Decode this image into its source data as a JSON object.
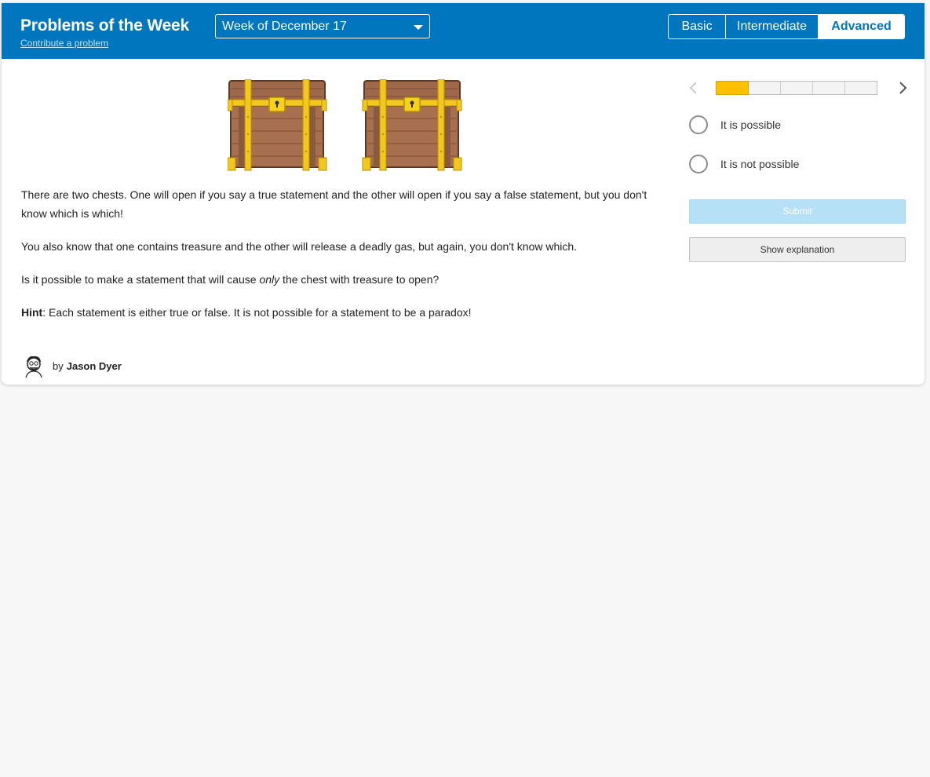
{
  "header": {
    "title": "Problems of the Week",
    "contribute_link": "Contribute a problem",
    "week_select": "Week of December 17",
    "levels": [
      {
        "label": "Basic",
        "selected": false
      },
      {
        "label": "Intermediate",
        "selected": false
      },
      {
        "label": "Advanced",
        "selected": true
      }
    ]
  },
  "problem": {
    "paragraphs": {
      "p1": "There are two chests. One will open if you say a true statement and the other will open if you say a false statement, but you don't know which is which!",
      "p2": "You also know that one contains treasure and the other will release a deadly gas, but again, you don't know which.",
      "p3_before": "Is it possible to make a statement that will cause ",
      "p3_emph": "only",
      "p3_after": " the chest with treasure to open?",
      "hint_label": "Hint",
      "hint_text": ": Each statement is either true or false. It is not possible for a statement to be a paradox!"
    },
    "images": [
      "treasure-chest-icon",
      "treasure-chest-icon"
    ]
  },
  "author": {
    "by": "by",
    "name": "Jason Dyer"
  },
  "pager": {
    "total_steps": 5,
    "current_step": 1
  },
  "answers": {
    "options": [
      "It is possible",
      "It is not possible"
    ],
    "submit_label": "Submit",
    "explain_label": "Show explanation"
  },
  "colors": {
    "header_bg": "#0076be",
    "progress_active": "#ffc000",
    "submit_disabled": "#b6e0f6"
  }
}
